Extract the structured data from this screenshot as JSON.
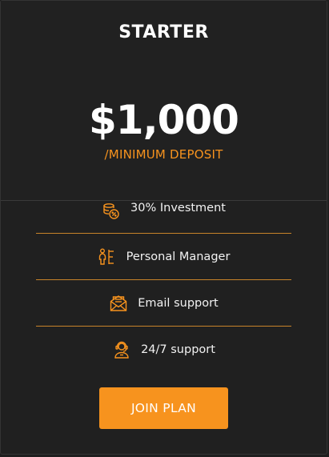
{
  "plan": {
    "title": "STARTER",
    "price": "$1,000",
    "price_caption": "/MINIMUM DEPOSIT"
  },
  "features": [
    {
      "icon": "coins-percent-icon",
      "label": "30% Investment"
    },
    {
      "icon": "manager-icon",
      "label": "Personal Manager"
    },
    {
      "icon": "email-icon",
      "label": "Email support"
    },
    {
      "icon": "support-agent-icon",
      "label": "24/7 support"
    }
  ],
  "cta": {
    "label": "JOIN PLAN"
  },
  "colors": {
    "accent": "#f7931e",
    "background": "#202020",
    "text": "#ffffff"
  }
}
